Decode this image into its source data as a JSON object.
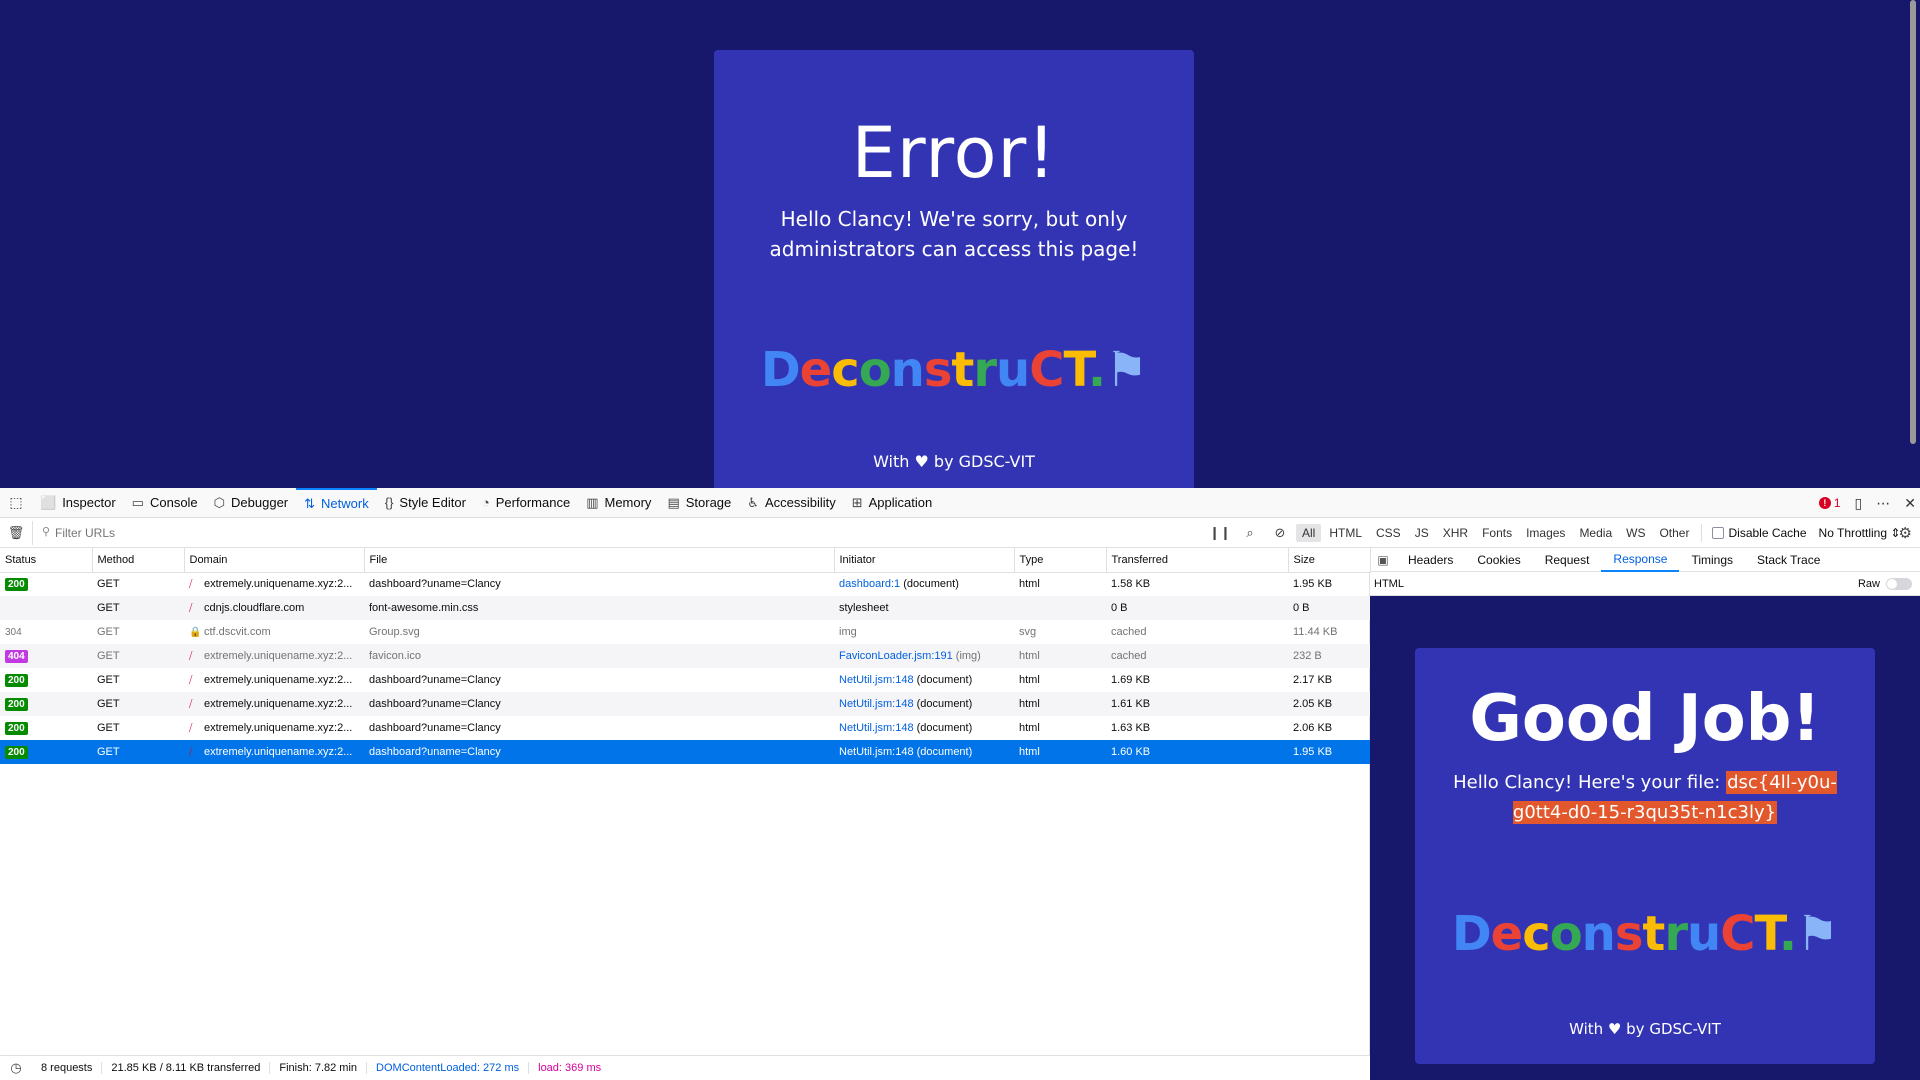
{
  "page": {
    "title": "Error!",
    "message": "Hello Clancy! We're sorry, but only administrators can access this page!",
    "logo_text": "DeconstruCT.",
    "footer": "With ♥ by GDSC-VIT"
  },
  "logo_colors": [
    "#4285f4",
    "#ea4335",
    "#fbbc05",
    "#34a853"
  ],
  "devtools": {
    "tabs": [
      {
        "label": "Inspector",
        "icon": "inspector-icon"
      },
      {
        "label": "Console",
        "icon": "console-icon"
      },
      {
        "label": "Debugger",
        "icon": "debugger-icon"
      },
      {
        "label": "Network",
        "icon": "network-icon"
      },
      {
        "label": "Style Editor",
        "icon": "style-editor-icon"
      },
      {
        "label": "Performance",
        "icon": "performance-icon"
      },
      {
        "label": "Memory",
        "icon": "memory-icon"
      },
      {
        "label": "Storage",
        "icon": "storage-icon"
      },
      {
        "label": "Accessibility",
        "icon": "accessibility-icon"
      },
      {
        "label": "Application",
        "icon": "application-icon"
      }
    ],
    "error_count": "1",
    "filter_placeholder": "Filter URLs",
    "type_filters": [
      "All",
      "HTML",
      "CSS",
      "JS",
      "XHR",
      "Fonts",
      "Images",
      "Media",
      "WS",
      "Other"
    ],
    "disable_cache": "Disable Cache",
    "throttling": "No Throttling ⇕",
    "columns": [
      "Status",
      "Method",
      "Domain",
      "File",
      "Initiator",
      "Type",
      "Transferred",
      "Size"
    ],
    "rows": [
      {
        "status": "200",
        "method": "GET",
        "domain": "extremely.uniquename.xyz:2...",
        "file": "dashboard?uname=Clancy",
        "initiator_link": "dashboard:1",
        "initiator_rest": " (document)",
        "type": "html",
        "transferred": "1.58 KB",
        "size": "1.95 KB"
      },
      {
        "status": "",
        "method": "GET",
        "domain": "cdnjs.cloudflare.com",
        "file": "font-awesome.min.css",
        "initiator_link": "",
        "initiator_rest": "stylesheet",
        "type": "",
        "transferred": "0 B",
        "size": "0 B"
      },
      {
        "status": "304",
        "method": "GET",
        "domain": "ctf.dscvit.com",
        "file": "Group.svg",
        "initiator_link": "",
        "initiator_rest": "img",
        "type": "svg",
        "transferred": "cached",
        "size": "11.44 KB"
      },
      {
        "status": "404",
        "method": "GET",
        "domain": "extremely.uniquename.xyz:2...",
        "file": "favicon.ico",
        "initiator_link": "FaviconLoader.jsm:191",
        "initiator_rest": " (img)",
        "type": "html",
        "transferred": "cached",
        "size": "232 B"
      },
      {
        "status": "200",
        "method": "GET",
        "domain": "extremely.uniquename.xyz:2...",
        "file": "dashboard?uname=Clancy",
        "initiator_link": "NetUtil.jsm:148",
        "initiator_rest": " (document)",
        "type": "html",
        "transferred": "1.69 KB",
        "size": "2.17 KB"
      },
      {
        "status": "200",
        "method": "GET",
        "domain": "extremely.uniquename.xyz:2...",
        "file": "dashboard?uname=Clancy",
        "initiator_link": "NetUtil.jsm:148",
        "initiator_rest": " (document)",
        "type": "html",
        "transferred": "1.61 KB",
        "size": "2.05 KB"
      },
      {
        "status": "200",
        "method": "GET",
        "domain": "extremely.uniquename.xyz:2...",
        "file": "dashboard?uname=Clancy",
        "initiator_link": "NetUtil.jsm:148",
        "initiator_rest": " (document)",
        "type": "html",
        "transferred": "1.63 KB",
        "size": "2.06 KB"
      },
      {
        "status": "200",
        "method": "GET",
        "domain": "extremely.uniquename.xyz:2...",
        "file": "dashboard?uname=Clancy",
        "initiator_link": "NetUtil.jsm:148",
        "initiator_rest": " (document)",
        "type": "html",
        "transferred": "1.60 KB",
        "size": "1.95 KB"
      }
    ],
    "status_bar": {
      "requests": "8 requests",
      "transferred": "21.85 KB / 8.11 KB transferred",
      "finish": "Finish: 7.82 min",
      "dcl": "DOMContentLoaded: 272 ms",
      "load": "load: 369 ms"
    },
    "side_tabs": [
      "Headers",
      "Cookies",
      "Request",
      "Response",
      "Timings",
      "Stack Trace"
    ],
    "response_label": "HTML",
    "raw_label": "Raw"
  },
  "preview": {
    "title": "Good Job!",
    "message_prefix": "Hello Clancy! Here's your file: ",
    "flag": "dsc{4ll-y0u-g0tt4-d0-15-r3qu35t-n1c3ly}",
    "logo_text": "DeconstruCT.",
    "footer": "With ♥ by GDSC-VIT"
  }
}
